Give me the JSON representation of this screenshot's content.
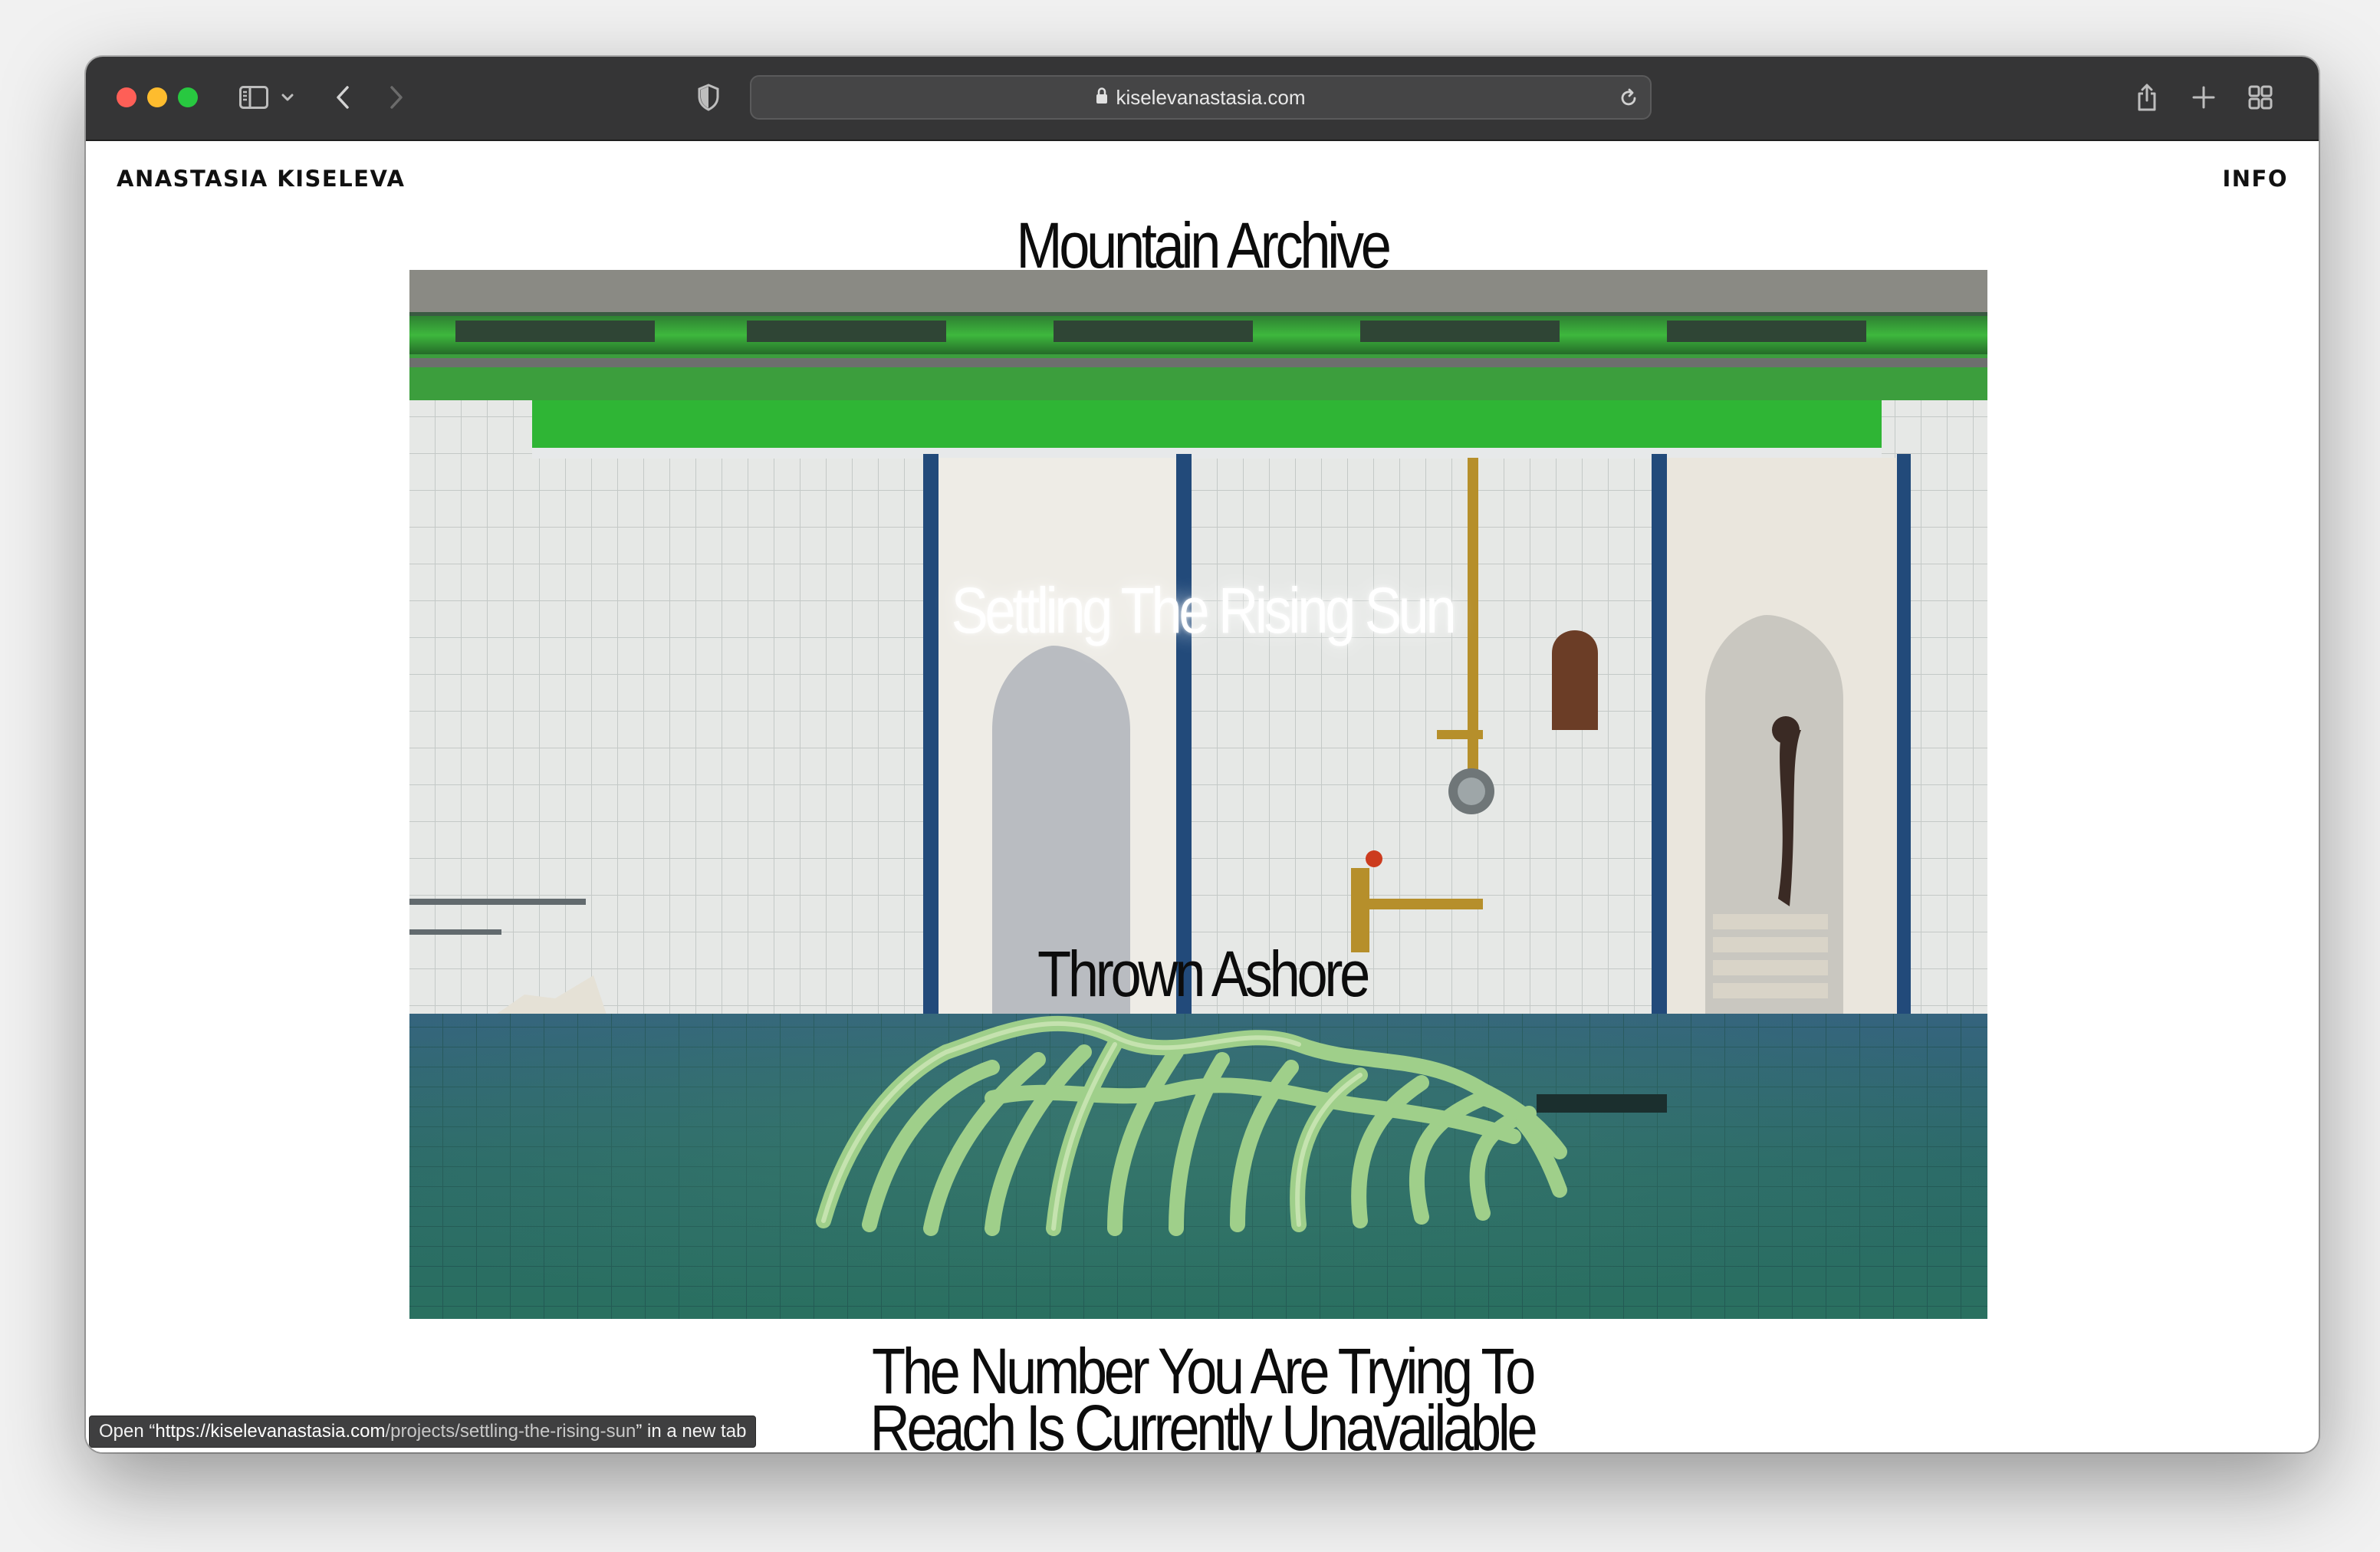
{
  "browser": {
    "url": "kiselevanastasia.com",
    "status_prefix": "Open “",
    "status_url_host": "https://kiselevanastasia.com",
    "status_url_path": "/projects/settling-the-rising-sun",
    "status_suffix": "” in a new tab"
  },
  "header": {
    "site_name": "ANASTASIA KISELEVA",
    "info_link": "INFO"
  },
  "projects": {
    "mountain_archive": "Mountain Archive",
    "settling_the_rising_sun": "Settling The Rising Sun",
    "thrown_ashore": "Thrown Ashore",
    "number_line_1": "The Number You Are Trying To",
    "number_line_2": "Reach Is Currently Unavailable"
  },
  "colors": {
    "titlebar": "#353536",
    "page_background": "#ffffff",
    "text": "#0c0c0c",
    "highlight_text": "#ffffff"
  }
}
